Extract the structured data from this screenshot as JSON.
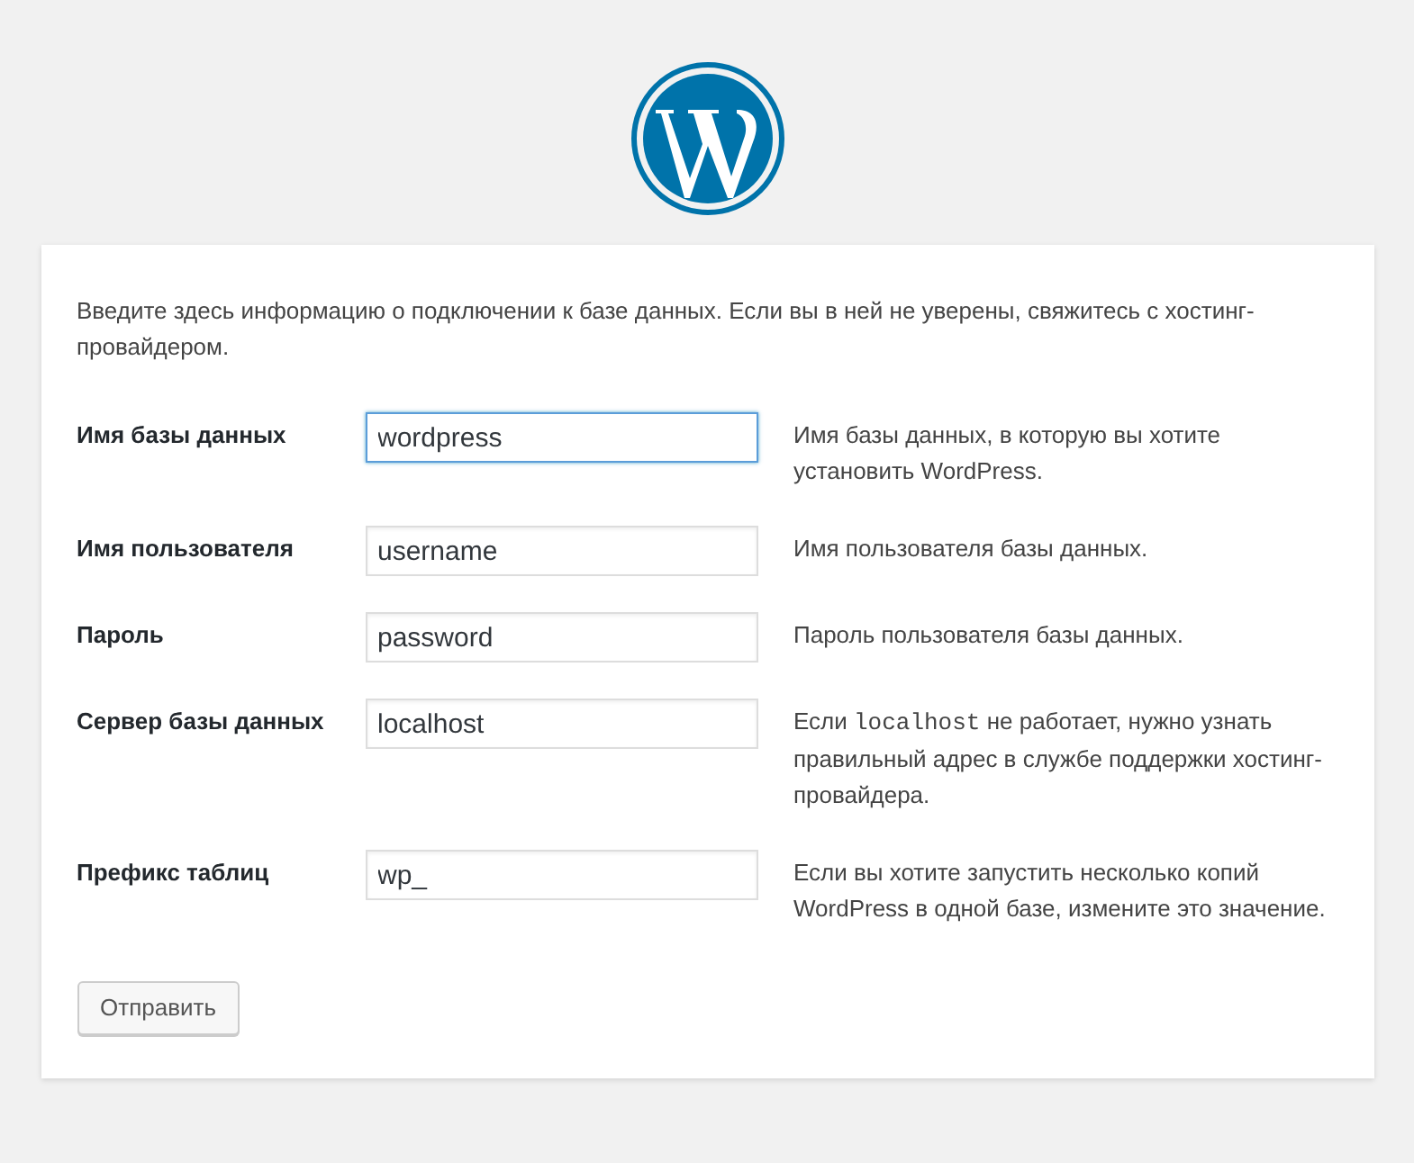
{
  "intro": "Введите здесь информацию о подключении к базе данных. Если вы в ней не уверены, свяжитесь с хостинг-провайдером.",
  "fields": [
    {
      "label": "Имя базы данных",
      "value": "wordpress",
      "focused": true,
      "hint": [
        {
          "kind": "text",
          "text": "Имя базы данных, в которую вы хотите установить WordPress."
        }
      ]
    },
    {
      "label": "Имя пользователя",
      "value": "username",
      "focused": false,
      "hint": [
        {
          "kind": "text",
          "text": "Имя пользователя базы данных."
        }
      ]
    },
    {
      "label": "Пароль",
      "value": "password",
      "focused": false,
      "hint": [
        {
          "kind": "text",
          "text": "Пароль пользователя базы данных."
        }
      ]
    },
    {
      "label": "Сервер базы данных",
      "value": "localhost",
      "focused": false,
      "hint": [
        {
          "kind": "text",
          "text": "Если "
        },
        {
          "kind": "code",
          "text": "localhost"
        },
        {
          "kind": "text",
          "text": " не работает, нужно узнать правильный адрес в службе поддержки хостинг-провайдера."
        }
      ]
    },
    {
      "label": "Префикс таблиц",
      "value": "wp_",
      "focused": false,
      "hint": [
        {
          "kind": "text",
          "text": "Если вы хотите запустить несколько копий WordPress в одной базе, измените это значение."
        }
      ]
    }
  ],
  "submit": "Отправить"
}
